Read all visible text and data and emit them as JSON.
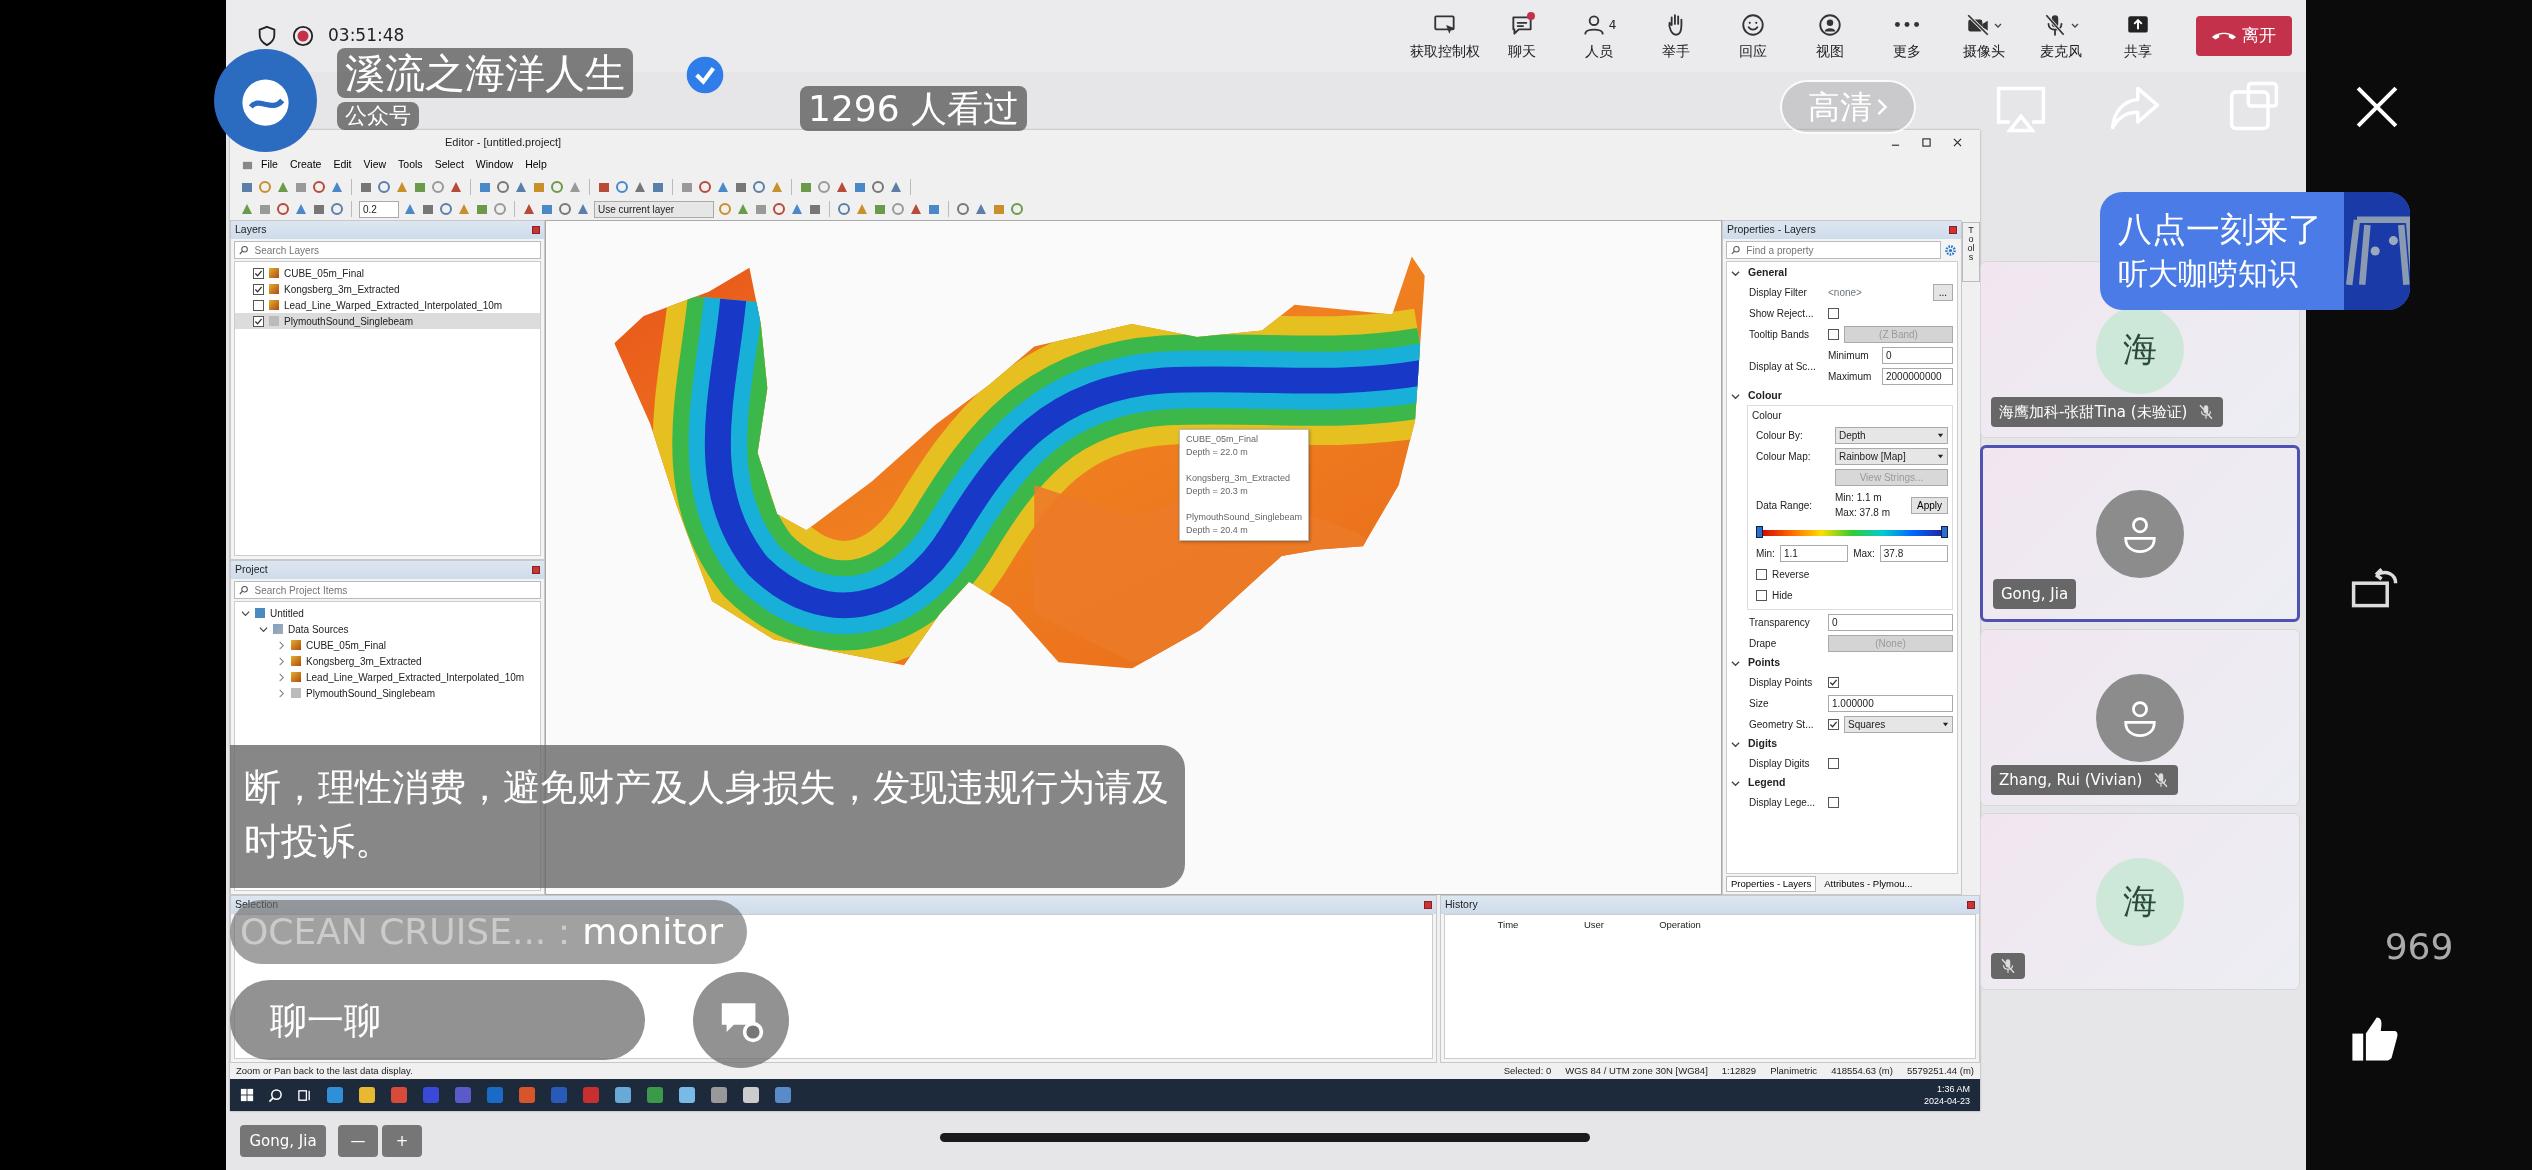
{
  "live": {
    "channel": "溪流之海洋人生",
    "channel_type": "公众号",
    "views": "1296 人看过",
    "quality": "高清",
    "banner": {
      "title": "八点一刻来了",
      "subtitle": "听大咖唠知识"
    },
    "notice": "断，理性消费，避免财产及人身损失，发现违规行为请及时投诉。",
    "comment": {
      "user": "OCEAN CRUISE...：",
      "text": "monitor"
    },
    "chat": {
      "placeholder": "聊一聊"
    },
    "likes": "969"
  },
  "meeting": {
    "time": "03:51:48",
    "toolbar": [
      {
        "label": "获取控制权",
        "kind": "control",
        "unread": false
      },
      {
        "label": "聊天",
        "kind": "chat",
        "unread": true
      },
      {
        "label": "人员",
        "kind": "people",
        "count": "4",
        "unread": false
      },
      {
        "label": "举手",
        "kind": "hand",
        "unread": false
      },
      {
        "label": "回应",
        "kind": "smile",
        "unread": false
      },
      {
        "label": "视图",
        "kind": "view",
        "unread": false
      },
      {
        "label": "更多",
        "kind": "more",
        "unread": false
      },
      {
        "label": "摄像头",
        "kind": "camera-off",
        "unread": false
      },
      {
        "label": "麦克风",
        "kind": "mic-off",
        "unread": false
      },
      {
        "label": "共享",
        "kind": "share",
        "unread": false
      }
    ],
    "leave": "离开",
    "participants": [
      {
        "kind": "initial",
        "avatar": "海",
        "name": "海鹰加科-张甜Tina (未验证)",
        "muted": true,
        "selected": false
      },
      {
        "kind": "person",
        "name": "Gong, Jia",
        "muted": false,
        "selected": true
      },
      {
        "kind": "person",
        "name": "Zhang, Rui (Vivian)",
        "muted": true,
        "selected": false
      },
      {
        "kind": "initial",
        "avatar": "海",
        "muted": true,
        "selected": false
      }
    ],
    "self_view": {
      "name": "Gong, Jia",
      "controls": [
        "—",
        "+"
      ]
    }
  },
  "app": {
    "title": "Editor - [untitled.project]",
    "menu": [
      "File",
      "Create",
      "Edit",
      "View",
      "Tools",
      "Select",
      "Window",
      "Help"
    ],
    "toolbar": {
      "step": "0.2",
      "target": "Use current layer"
    },
    "layers": {
      "title": "Layers",
      "placeholder": "Search Layers",
      "items": [
        {
          "name": "CUBE_05m_Final",
          "kind": "raster",
          "checked": true,
          "selected": false
        },
        {
          "name": "Kongsberg_3m_Extracted",
          "kind": "raster",
          "checked": true,
          "selected": false
        },
        {
          "name": "Lead_Line_Warped_Extracted_Interpolated_10m",
          "kind": "raster",
          "checked": false,
          "selected": false
        },
        {
          "name": "PlymouthSound_Singlebeam",
          "kind": "points",
          "checked": true,
          "selected": true
        }
      ]
    },
    "project": {
      "title": "Project",
      "placeholder": "Search Project Items",
      "tree": [
        {
          "label": "Untitled",
          "kind": "project",
          "expanded": true,
          "children": [
            {
              "label": "Data Sources",
              "kind": "folder",
              "expanded": true,
              "children": [
                {
                  "label": "CUBE_05m_Final",
                  "kind": "raster",
                  "expanded": false
                },
                {
                  "label": "Kongsberg_3m_Extracted",
                  "kind": "raster",
                  "expanded": false
                },
                {
                  "label": "Lead_Line_Warped_Extracted_Interpolated_10m",
                  "kind": "raster",
                  "expanded": false
                },
                {
                  "label": "PlymouthSound_Singlebeam",
                  "kind": "points",
                  "expanded": false
                }
              ]
            }
          ]
        }
      ]
    },
    "tooltip": [
      {
        "layer": "CUBE_05m_Final",
        "reading": "Depth = 22.0 m"
      },
      {
        "layer": "Kongsberg_3m_Extracted",
        "reading": "Depth = 20.3 m"
      },
      {
        "layer": "PlymouthSound_Singlebeam",
        "reading": "Depth = 20.4 m"
      }
    ],
    "properties": {
      "title": "Properties - Layers",
      "placeholder": "Find a property",
      "tools_tab": "Tools",
      "sections": [
        {
          "title": "General",
          "expanded": true,
          "rows": [
            {
              "kind": "note",
              "label": "Display Filter",
              "value": "<none>",
              "button": "..."
            },
            {
              "kind": "check",
              "label": "Show Reject...",
              "checked": false
            },
            {
              "kind": "check-select",
              "label": "Tooltip Bands",
              "checked": false,
              "value": "(Z Band)",
              "disabled": true
            },
            {
              "kind": "scale",
              "label": "Display at Sc...",
              "min_label": "Minimum",
              "min": "0",
              "max_label": "Maximum",
              "max": "2000000000"
            }
          ]
        },
        {
          "title": "Colour",
          "expanded": true,
          "group": {
            "title": "Colour",
            "rows": [
              {
                "kind": "select",
                "label": "Colour By:",
                "value": "Depth",
                "disabled": false
              },
              {
                "kind": "select",
                "label": "Colour Map:",
                "value": "Rainbow [Map]",
                "disabled": false
              },
              {
                "kind": "button",
                "label": "View Strings...",
                "disabled": true
              },
              {
                "kind": "range",
                "label": "Data Range:",
                "min": "Min:  1.1 m",
                "max": "Max: 37.8 m",
                "button": "Apply"
              },
              {
                "kind": "ramp"
              },
              {
                "kind": "pair",
                "min_label": "Min:",
                "min": "1.1",
                "max_label": "Max:",
                "max": "37.8"
              },
              {
                "kind": "option",
                "label": "Reverse",
                "checked": false
              },
              {
                "kind": "option",
                "label": "Hide",
                "checked": false
              }
            ]
          },
          "rows": [
            {
              "kind": "input",
              "label": "Transparency",
              "value": "0"
            },
            {
              "kind": "select",
              "label": "Drape",
              "value": "(None)",
              "disabled": true
            }
          ]
        },
        {
          "title": "Points",
          "expanded": true,
          "rows": [
            {
              "kind": "check",
              "label": "Display Points",
              "checked": true
            },
            {
              "kind": "input",
              "label": "Size",
              "value": "1.000000"
            },
            {
              "kind": "check-select",
              "label": "Geometry St...",
              "checked": true,
              "value": "Squares",
              "disabled": false
            }
          ]
        },
        {
          "title": "Digits",
          "expanded": true,
          "rows": [
            {
              "kind": "check",
              "label": "Display Digits",
              "checked": false
            }
          ]
        },
        {
          "title": "Legend",
          "expanded": true,
          "rows": [
            {
              "kind": "check",
              "label": "Display Lege...",
              "checked": false
            }
          ]
        }
      ],
      "tabs": [
        {
          "label": "Properties - Layers",
          "selected": true
        },
        {
          "label": "Attributes - Plymou...",
          "selected": false
        }
      ]
    },
    "selection": {
      "title": "Selection"
    },
    "history": {
      "title": "History",
      "columns": [
        "Time",
        "User",
        "Operation"
      ]
    },
    "status": {
      "message": "Zoom or Pan back to the last data display.",
      "fields": [
        "Selected: 0",
        "WGS 84 / UTM zone 30N [WG84]",
        "1:12829",
        "Planimetric",
        "418554.63 (m)",
        "5579251.44 (m)"
      ]
    },
    "taskbar": {
      "time": "1:36 AM",
      "date": "2024-04-23"
    }
  }
}
